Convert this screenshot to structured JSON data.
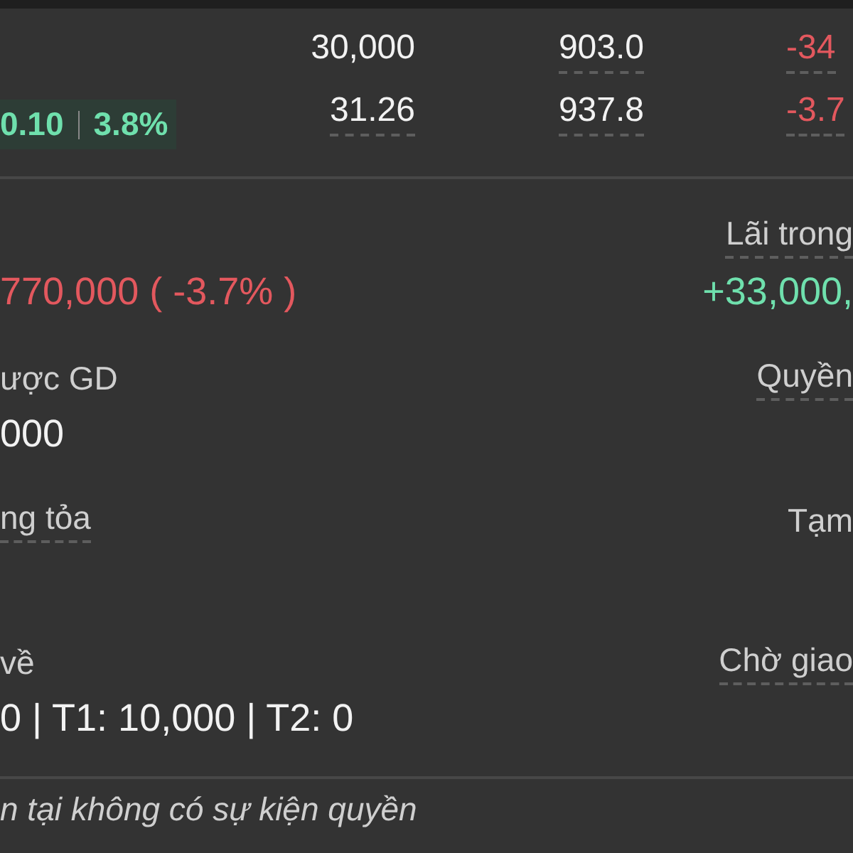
{
  "quote": {
    "change": "0.10",
    "change_percent": "3.8%",
    "columns": [
      {
        "top": {
          "text": "30,000",
          "color": "#f2f2f2",
          "underlined": false
        },
        "bottom": {
          "text": "31.26",
          "color": "#f2f2f2",
          "underlined": true
        }
      },
      {
        "top": {
          "text": "903.0",
          "color": "#f2f2f2",
          "underlined": true
        },
        "bottom": {
          "text": "937.8",
          "color": "#f2f2f2",
          "underlined": true
        }
      },
      {
        "top": {
          "text": "-34",
          "color": "#e3585e",
          "underlined": true
        },
        "bottom": {
          "text": "-3.7",
          "color": "#e3585e",
          "underlined": true
        }
      }
    ]
  },
  "position": {
    "rows": [
      {
        "left": {
          "value": "770,000 ( -3.7% )",
          "color": "#e3585e"
        },
        "right": {
          "label": "Lãi trong",
          "underlined": true,
          "value": "+33,000,",
          "color": "#6fe0ad"
        }
      },
      {
        "left": {
          "label": "ược GD",
          "underlined": false,
          "value": "000",
          "color": "#f2f2f2"
        },
        "right": {
          "label": "Quyền",
          "underlined": true
        }
      },
      {
        "left": {
          "label": "ng tỏa",
          "underlined": true
        },
        "right": {
          "label": "Tạm",
          "underlined": false
        }
      },
      {
        "left": {
          "label": "về",
          "underlined": false,
          "value": "0 | T1: 10,000 | T2: 0",
          "color": "#f2f2f2"
        },
        "right": {
          "label": "Chờ giao",
          "underlined": true
        }
      }
    ]
  },
  "rights_note": "n tại không có sự kiện quyền"
}
